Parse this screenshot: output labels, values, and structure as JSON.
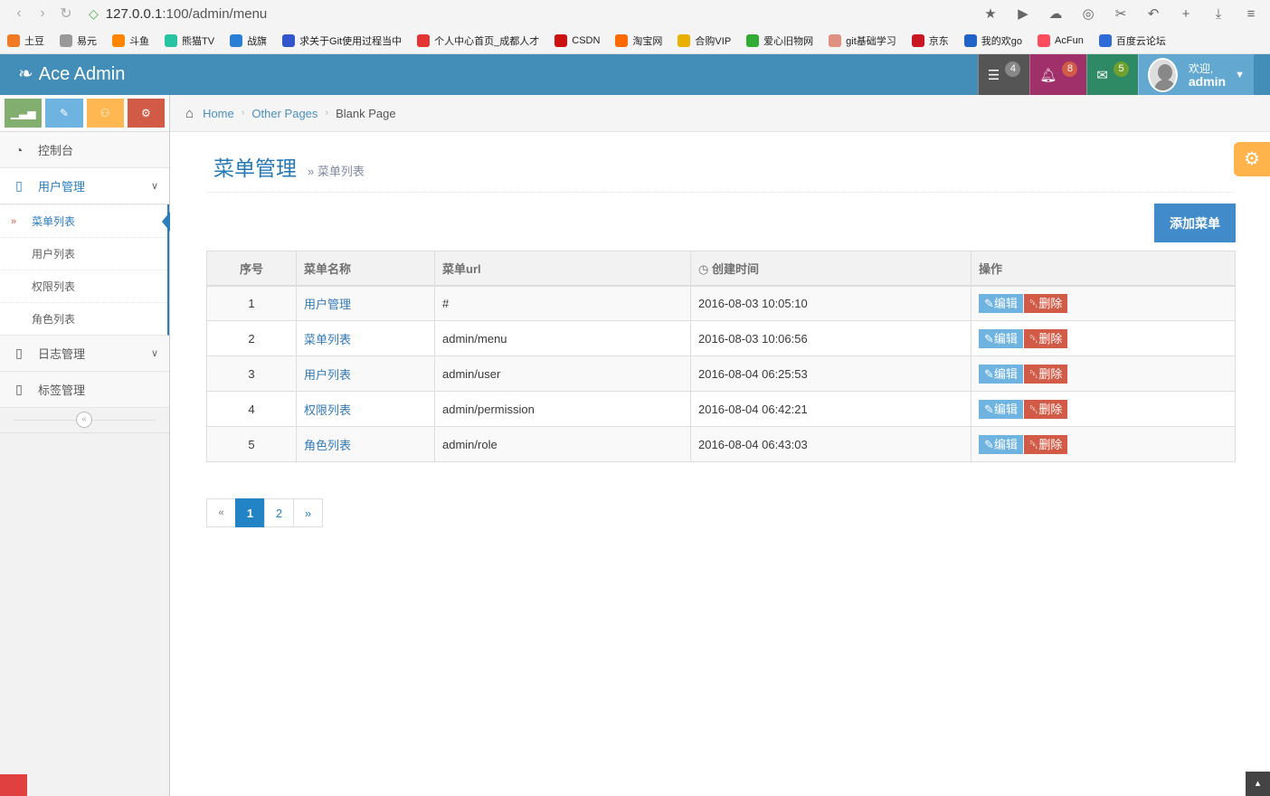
{
  "browser": {
    "url_host": "127.0.0.1",
    "url_path": ":100/admin/menu",
    "bookmarks": [
      {
        "label": "土豆",
        "color": "#f07a23"
      },
      {
        "label": "易元",
        "color": "#999999"
      },
      {
        "label": "斗鱼",
        "color": "#ff8400"
      },
      {
        "label": "熊猫TV",
        "color": "#28c3a0"
      },
      {
        "label": "战旗",
        "color": "#2a7fd4"
      },
      {
        "label": "求关于Git使用过程当中",
        "color": "#3355cc"
      },
      {
        "label": "个人中心首页_成都人才",
        "color": "#e33333"
      },
      {
        "label": "CSDN",
        "color": "#cc1111"
      },
      {
        "label": "淘宝网",
        "color": "#ff6a00"
      },
      {
        "label": "合购VIP",
        "color": "#e8b000"
      },
      {
        "label": "爱心旧物网",
        "color": "#33aa33"
      },
      {
        "label": "git基础学习",
        "color": "#e09080"
      },
      {
        "label": "京东",
        "color": "#c91623"
      },
      {
        "label": "我的欢go",
        "color": "#1f63c6"
      },
      {
        "label": "AcFun",
        "color": "#fd4c5d"
      },
      {
        "label": "百度云论坛",
        "color": "#2e6bd6"
      }
    ]
  },
  "navbar": {
    "brand": "Ace Admin",
    "tasks_count": "4",
    "notif_count": "8",
    "msg_count": "5",
    "welcome": "欢迎,",
    "username": "admin"
  },
  "sidebar": {
    "items": [
      {
        "label": "控制台"
      },
      {
        "label": "用户管理"
      },
      {
        "label": "日志管理"
      },
      {
        "label": "标签管理"
      }
    ],
    "submenu": [
      {
        "label": "菜单列表"
      },
      {
        "label": "用户列表"
      },
      {
        "label": "权限列表"
      },
      {
        "label": "角色列表"
      }
    ]
  },
  "breadcrumb": {
    "home": "Home",
    "section": "Other Pages",
    "current": "Blank Page"
  },
  "page": {
    "title": "菜单管理",
    "subtitle": "» 菜单列表",
    "add_button": "添加菜单"
  },
  "table": {
    "headers": [
      "序号",
      "菜单名称",
      "菜单url",
      "创建时间",
      "操作"
    ],
    "edit_label": "编辑",
    "delete_label": "删除",
    "rows": [
      {
        "no": "1",
        "name": "用户管理",
        "url": "#",
        "created": "2016-08-03 10:05:10"
      },
      {
        "no": "2",
        "name": "菜单列表",
        "url": "admin/menu",
        "created": "2016-08-03 10:06:56"
      },
      {
        "no": "3",
        "name": "用户列表",
        "url": "admin/user",
        "created": "2016-08-04 06:25:53"
      },
      {
        "no": "4",
        "name": "权限列表",
        "url": "admin/permission",
        "created": "2016-08-04 06:42:21"
      },
      {
        "no": "5",
        "name": "角色列表",
        "url": "admin/role",
        "created": "2016-08-04 06:43:03"
      }
    ]
  },
  "pagination": {
    "prev": "«",
    "pages": [
      "1",
      "2"
    ],
    "next": "»",
    "current": "1"
  }
}
